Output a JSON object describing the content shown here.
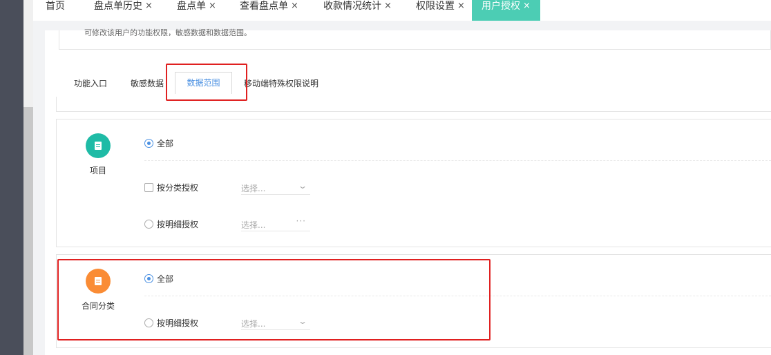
{
  "top_tabs": [
    {
      "label": "首页",
      "closable": false
    },
    {
      "label": "盘点单历史",
      "closable": true
    },
    {
      "label": "盘点单",
      "closable": true
    },
    {
      "label": "查看盘点单",
      "closable": true
    },
    {
      "label": "收款情况统计",
      "closable": true
    },
    {
      "label": "权限设置",
      "closable": true
    },
    {
      "label": "用户授权",
      "closable": true,
      "active": true
    }
  ],
  "close_glyph": "×",
  "description": "可修改该用户的功能权限，敏感数据和数据范围。",
  "sub_tabs": [
    "功能入口",
    "敏感数据",
    "数据范围",
    "移动端特殊权限说明"
  ],
  "sub_tab_active": "数据范围",
  "sections": {
    "project": {
      "label": "项目",
      "icon": "document-icon",
      "option_all": "全部",
      "option_by_category": "按分类授权",
      "option_by_detail": "按明细授权",
      "select_placeholder": "选择...",
      "selected": "全部"
    },
    "contract_category": {
      "label": "合同分类",
      "icon": "contract-icon",
      "option_all": "全部",
      "option_by_detail": "按明细授权",
      "select_placeholder": "选择...",
      "selected": "全部"
    }
  },
  "colors": {
    "accent": "#4ccdb4",
    "teal_icon": "#1fbba6",
    "orange_icon": "#fa8c35",
    "highlight": "#e02020",
    "link_blue": "#4a90e2"
  }
}
